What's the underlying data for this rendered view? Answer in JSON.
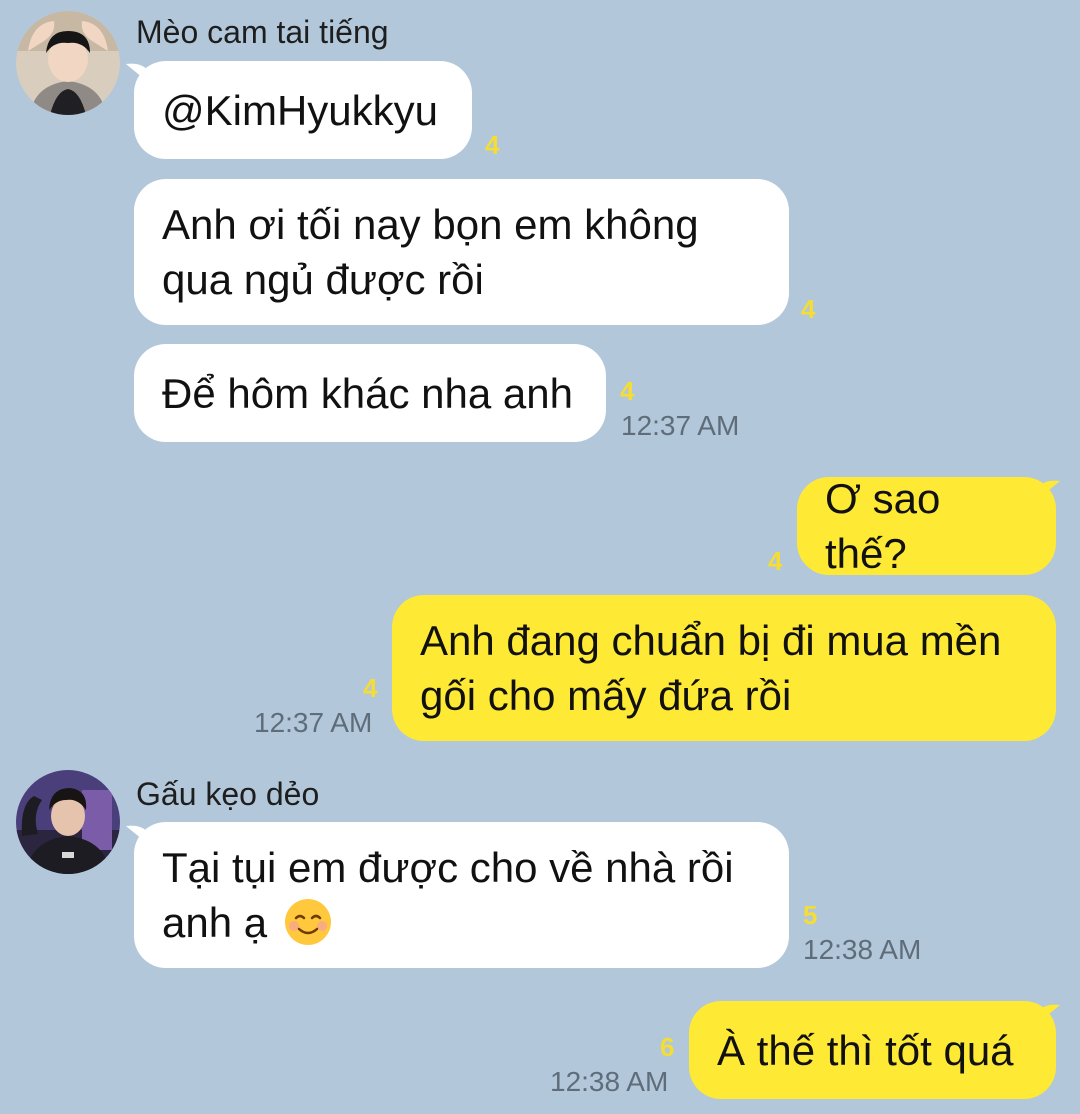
{
  "conversation": {
    "senders": {
      "first": {
        "name": "Mèo cam tai tiếng"
      },
      "second": {
        "name": "Gấu kẹo dẻo"
      }
    },
    "messages": [
      {
        "text": "@KimHyukkyu",
        "unread": "4"
      },
      {
        "text": "Anh ơi tối nay bọn em không qua ngủ được rồi",
        "line1": "Anh ơi tối nay bọn em không",
        "line2": "qua ngủ được rồi",
        "unread": "4"
      },
      {
        "text": "Để hôm khác nha anh",
        "unread": "4",
        "time": "12:37 AM"
      },
      {
        "text": "Ơ sao thế?",
        "unread": "4"
      },
      {
        "text": "Anh đang chuẩn bị đi mua mền gối cho mấy đứa rồi",
        "line1": "Anh đang chuẩn bị đi mua mền",
        "line2": "gối cho mấy đứa rồi",
        "unread": "4",
        "time": "12:37 AM"
      },
      {
        "text": "Tại tụi em được cho về nhà rồi anh ạ ☺️",
        "line1": "Tại tụi em được cho về nhà rồi",
        "line2": "anh ạ",
        "emoji": "smiling-face-icon",
        "unread": "5",
        "time": "12:38 AM"
      },
      {
        "text": "À thế thì tốt quá",
        "unread": "6",
        "time": "12:38 AM"
      }
    ]
  },
  "colors": {
    "background": "#b2c7da",
    "incoming_bubble": "#ffffff",
    "outgoing_bubble": "#fee934",
    "unread_count": "#f5dd33",
    "timestamp": "#5f6d7a"
  }
}
